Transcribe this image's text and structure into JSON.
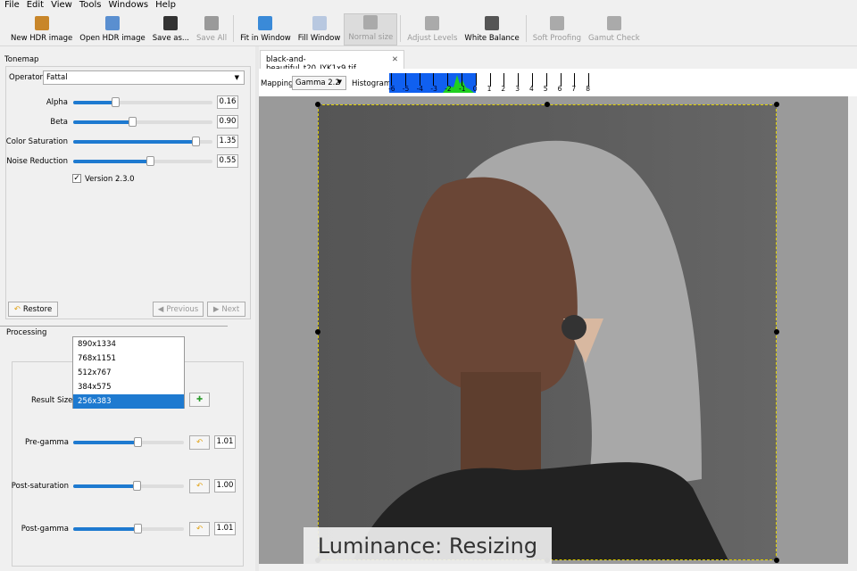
{
  "menu": [
    "File",
    "Edit",
    "View",
    "Tools",
    "Windows",
    "Help"
  ],
  "toolbar": [
    {
      "label": "New HDR image",
      "icon": "new-hdr-icon",
      "enabled": true,
      "color": "#c8862a"
    },
    {
      "label": "Open HDR image",
      "icon": "open-hdr-icon",
      "enabled": true,
      "color": "#5a8fd0"
    },
    {
      "label": "Save as...",
      "icon": "save-icon",
      "enabled": true,
      "color": "#333333"
    },
    {
      "label": "Save All",
      "icon": "save-all-icon",
      "enabled": false,
      "color": "#9a9a9a"
    },
    {
      "label": "Fit in Window",
      "icon": "zoom-fit-icon",
      "enabled": true,
      "color": "#3a8ad8"
    },
    {
      "label": "Fill Window",
      "icon": "fill-window-icon",
      "enabled": true,
      "color": "#b8c8e0"
    },
    {
      "label": "Normal size",
      "icon": "zoom-normal-icon",
      "enabled": false,
      "active": true,
      "color": "#aaaaaa"
    },
    {
      "label": "Adjust Levels",
      "icon": "levels-icon",
      "enabled": false,
      "color": "#aaaaaa"
    },
    {
      "label": "White Balance",
      "icon": "drop-icon",
      "enabled": true,
      "color": "#555555"
    },
    {
      "label": "Soft Proofing",
      "icon": "printer-icon",
      "enabled": false,
      "color": "#aaaaaa"
    },
    {
      "label": "Gamut Check",
      "icon": "gamut-icon",
      "enabled": false,
      "color": "#aaaaaa"
    }
  ],
  "tonemap": {
    "title": "Tonemap",
    "operator_label": "Operator",
    "operator": "Fattal",
    "params": [
      {
        "label": "Alpha",
        "value": "0.16",
        "fraction": 0.3
      },
      {
        "label": "Beta",
        "value": "0.90",
        "fraction": 0.42
      },
      {
        "label": "Color Saturation",
        "value": "1.35",
        "fraction": 0.88
      },
      {
        "label": "Noise Reduction",
        "value": "0.55",
        "fraction": 0.55
      }
    ],
    "version_checked": true,
    "version_label": "Version 2.3.0",
    "restore": "Restore",
    "previous": "Previous",
    "next": "Next"
  },
  "processing": {
    "title": "Processing",
    "result_size_label": "Result Size",
    "size_options": [
      "890x1334",
      "768x1151",
      "512x767",
      "384x575",
      "256x383"
    ],
    "selected_size": "256x383",
    "params": [
      {
        "label": "Pre-gamma",
        "value": "1.01",
        "fraction": 0.58
      },
      {
        "label": "Post-saturation",
        "value": "1.00",
        "fraction": 0.57
      },
      {
        "label": "Post-gamma",
        "value": "1.01",
        "fraction": 0.58
      }
    ]
  },
  "tab": {
    "filename": "black-and-beautiful_t20_JYK1x9.tif"
  },
  "mapping": {
    "label": "Mapping:",
    "value": "Gamma 2.2",
    "histogram_label": "Histogram:",
    "ticks": [
      "-6",
      "-5",
      "-4",
      "-3",
      "-2",
      "-1",
      "0",
      "1",
      "2",
      "3",
      "4",
      "5",
      "6",
      "7",
      "8"
    ]
  },
  "caption": "Luminance: Resizing"
}
